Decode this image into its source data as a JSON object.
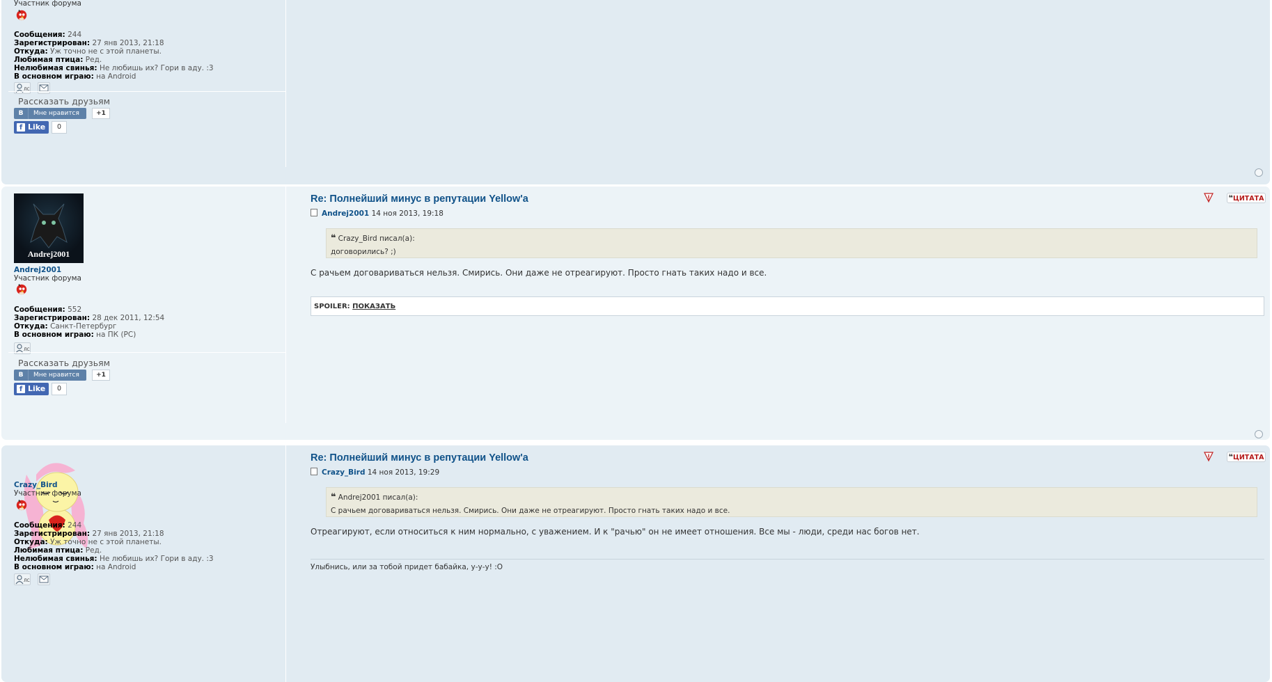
{
  "posts": [
    {
      "author": {
        "name": "",
        "rank": "Участник форума",
        "details": [
          {
            "label": "Сообщения:",
            "value": "244"
          },
          {
            "label": "Зарегистрирован:",
            "value": "27 янв 2013, 21:18"
          },
          {
            "label": "Откуда:",
            "value": "Уж точно не с этой планеты."
          },
          {
            "label": "Любимая птица:",
            "value": "Ред."
          },
          {
            "label": "Нелюбимая свинья:",
            "value": "Не любишь их? Гори в аду. :3"
          },
          {
            "label": "В основном играю:",
            "value": "на Android"
          }
        ]
      },
      "share": {
        "title": "Рассказать друзьям",
        "vk_label": "Мне нравится",
        "vk_letter": "В",
        "vk_count": "+1",
        "fb_label": "Like",
        "fb_count": "0"
      }
    },
    {
      "author": {
        "name": "Andrej2001",
        "avatar_text": "Andrej2001",
        "rank": "Участник форума",
        "details": [
          {
            "label": "Сообщения:",
            "value": "552"
          },
          {
            "label": "Зарегистрирован:",
            "value": "28 дек 2011, 12:54"
          },
          {
            "label": "Откуда:",
            "value": "Санкт-Петербург"
          },
          {
            "label": "В основном играю:",
            "value": "на ПК (PC)"
          }
        ]
      },
      "title": "Re: Полнейший минус в репутации Yellow'a",
      "meta_author": "Andrej2001",
      "meta_date": "14 ноя 2013, 19:18",
      "quote": {
        "cite": "Crazy_Bird писал(а):",
        "text": "договорились? ;)"
      },
      "text": "С рачьем договариваться нельзя. Смирись. Они даже не отреагируют. Просто гнать таких надо и все.",
      "spoiler": {
        "label": "SPOILER:",
        "link": "ПОКАЗАТЬ"
      },
      "quote_button": "ЦИТАТА",
      "share": {
        "title": "Рассказать друзьям",
        "vk_label": "Мне нравится",
        "vk_letter": "В",
        "vk_count": "+1",
        "fb_label": "Like",
        "fb_count": "0"
      }
    },
    {
      "author": {
        "name": "Crazy_Bird",
        "rank": "Участник форума",
        "details": [
          {
            "label": "Сообщения:",
            "value": "244"
          },
          {
            "label": "Зарегистрирован:",
            "value": "27 янв 2013, 21:18"
          },
          {
            "label": "Откуда:",
            "value": "Уж точно не с этой планеты."
          },
          {
            "label": "Любимая птица:",
            "value": "Ред."
          },
          {
            "label": "Нелюбимая свинья:",
            "value": "Не любишь их? Гори в аду. :3"
          },
          {
            "label": "В основном играю:",
            "value": "на Android"
          }
        ]
      },
      "title": "Re: Полнейший минус в репутации Yellow'a",
      "meta_author": "Crazy_Bird",
      "meta_date": "14 ноя 2013, 19:29",
      "quote": {
        "cite": "Andrej2001 писал(а):",
        "text": "С рачьем договариваться нельзя. Смирись. Они даже не отреагируют. Просто гнать таких надо и все."
      },
      "text": "Отреагируют, если относиться к ним нормально, с уважением. И к \"рачью\" он не имеет отношения. Все мы - люди, среди нас богов нет.",
      "signature": "Улыбнись, или за тобой придет бабайка, у-у-у! :O",
      "quote_button": "ЦИТАТА"
    }
  ],
  "pm_label": "ЛС",
  "colors": {
    "post_bg_a": "#e1ebf2",
    "post_bg_b": "#ecf3f7",
    "link": "#105289",
    "quote_bg": "#ebeadd"
  }
}
